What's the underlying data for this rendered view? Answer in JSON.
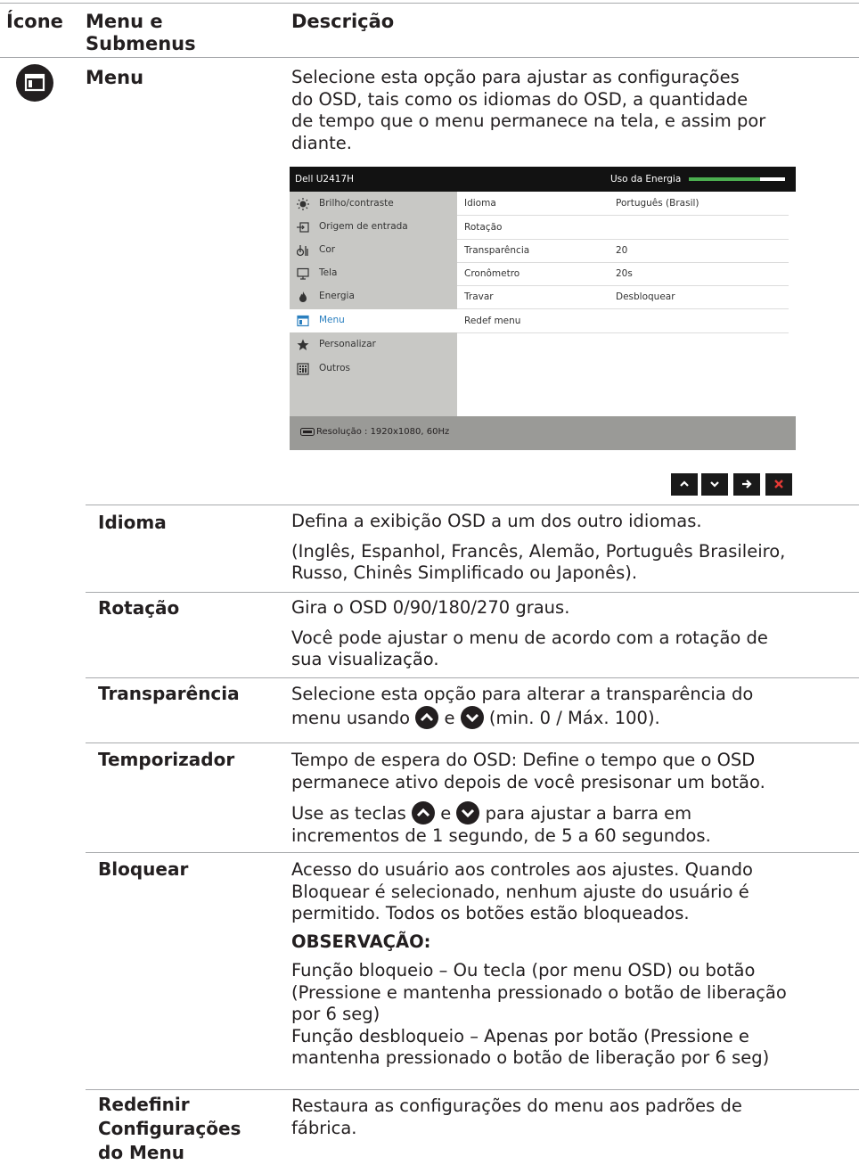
{
  "header": {
    "col_icon": "Ícone",
    "col_menu_line1": "Menu e",
    "col_menu_line2": "Submenus",
    "col_desc": "Descrição"
  },
  "main": {
    "icon_name": "menu-icon",
    "title": "Menu",
    "desc_lines": [
      "Selecione esta opção para ajustar as configurações",
      "do OSD, tais como os idiomas do OSD, a quantidade",
      "de tempo que o menu permanece na tela, e assim por",
      "diante."
    ]
  },
  "osd": {
    "model": "Dell U2417H",
    "energy_label": "Uso da Energia",
    "energy_level": 0.74,
    "menu_items": [
      {
        "label": "Brilho/contraste",
        "icon": "brightness-icon"
      },
      {
        "label": "Origem de entrada",
        "icon": "input-source-icon"
      },
      {
        "label": "Cor",
        "icon": "color-icon"
      },
      {
        "label": "Tela",
        "icon": "display-icon"
      },
      {
        "label": "Energia",
        "icon": "energy-icon"
      },
      {
        "label": "Menu",
        "icon": "menu-icon"
      },
      {
        "label": "Personalizar",
        "icon": "star-icon"
      },
      {
        "label": "Outros",
        "icon": "others-icon"
      }
    ],
    "selected_index": 5,
    "settings": [
      {
        "key": "Idioma",
        "value": "Português (Brasil)"
      },
      {
        "key": "Rotação",
        "value": ""
      },
      {
        "key": "Transparência",
        "value": "20"
      },
      {
        "key": "Cronômetro",
        "value": "20s"
      },
      {
        "key": "Travar",
        "value": "Desbloquear"
      },
      {
        "key": "Redef menu",
        "value": ""
      }
    ],
    "resolution": "Resolução : 1920x1080, 60Hz",
    "nav_buttons": [
      "up-icon",
      "down-icon",
      "right-arrow-icon",
      "close-icon"
    ]
  },
  "rows": {
    "idioma": {
      "label": "Idioma",
      "lines": [
        "Defina a exibição OSD a um dos outro idiomas.",
        "(Inglês, Espanhol, Francês, Alemão, Português Brasileiro,",
        "Russo, Chinês Simplificado ou Japonês)."
      ]
    },
    "rotacao": {
      "label": "Rotação",
      "lines": [
        "Gira o OSD 0/90/180/270 graus.",
        "Você pode ajustar o menu de acordo com a rotação de",
        "sua visualização."
      ]
    },
    "transparencia": {
      "label": "Transparência",
      "line1": "Selecione esta opção para alterar a transparência do",
      "line2_a": "menu usando",
      "line2_b": "e",
      "line2_c": "(min. 0 / Máx. 100)."
    },
    "temporizador": {
      "label": "Temporizador",
      "line1": "Tempo de espera do OSD: Define o tempo que o OSD",
      "line2": "permanece ativo depois de você presisonar um botão.",
      "line3_a": "Use as teclas",
      "line3_b": "e",
      "line3_c": "para ajustar a barra em",
      "line4": "incrementos de 1 segundo, de 5 a 60 segundos."
    },
    "bloquear": {
      "label": "Bloquear",
      "lines": [
        "Acesso do usuário aos controles aos ajustes. Quando",
        "Bloquear  é selecionado, nenhum ajuste do usuário é",
        "permitido. Todos os botões estão bloqueados."
      ],
      "note_title": "OBSERVAÇÃO:",
      "note_lines": [
        "Função bloqueio – Ou tecla (por menu OSD) ou botão",
        "(Pressione e mantenha pressionado o botão de liberação",
        "por 6 seg)",
        "Função desbloqueio – Apenas por botão (Pressione e",
        "mantenha pressionado o botão de liberação por 6 seg)"
      ]
    },
    "redefinir": {
      "label_lines": [
        "Redefinir",
        "Configurações",
        "do Menu"
      ],
      "lines": [
        "Restaura as configurações do menu aos padrões de",
        "fábrica."
      ]
    }
  }
}
